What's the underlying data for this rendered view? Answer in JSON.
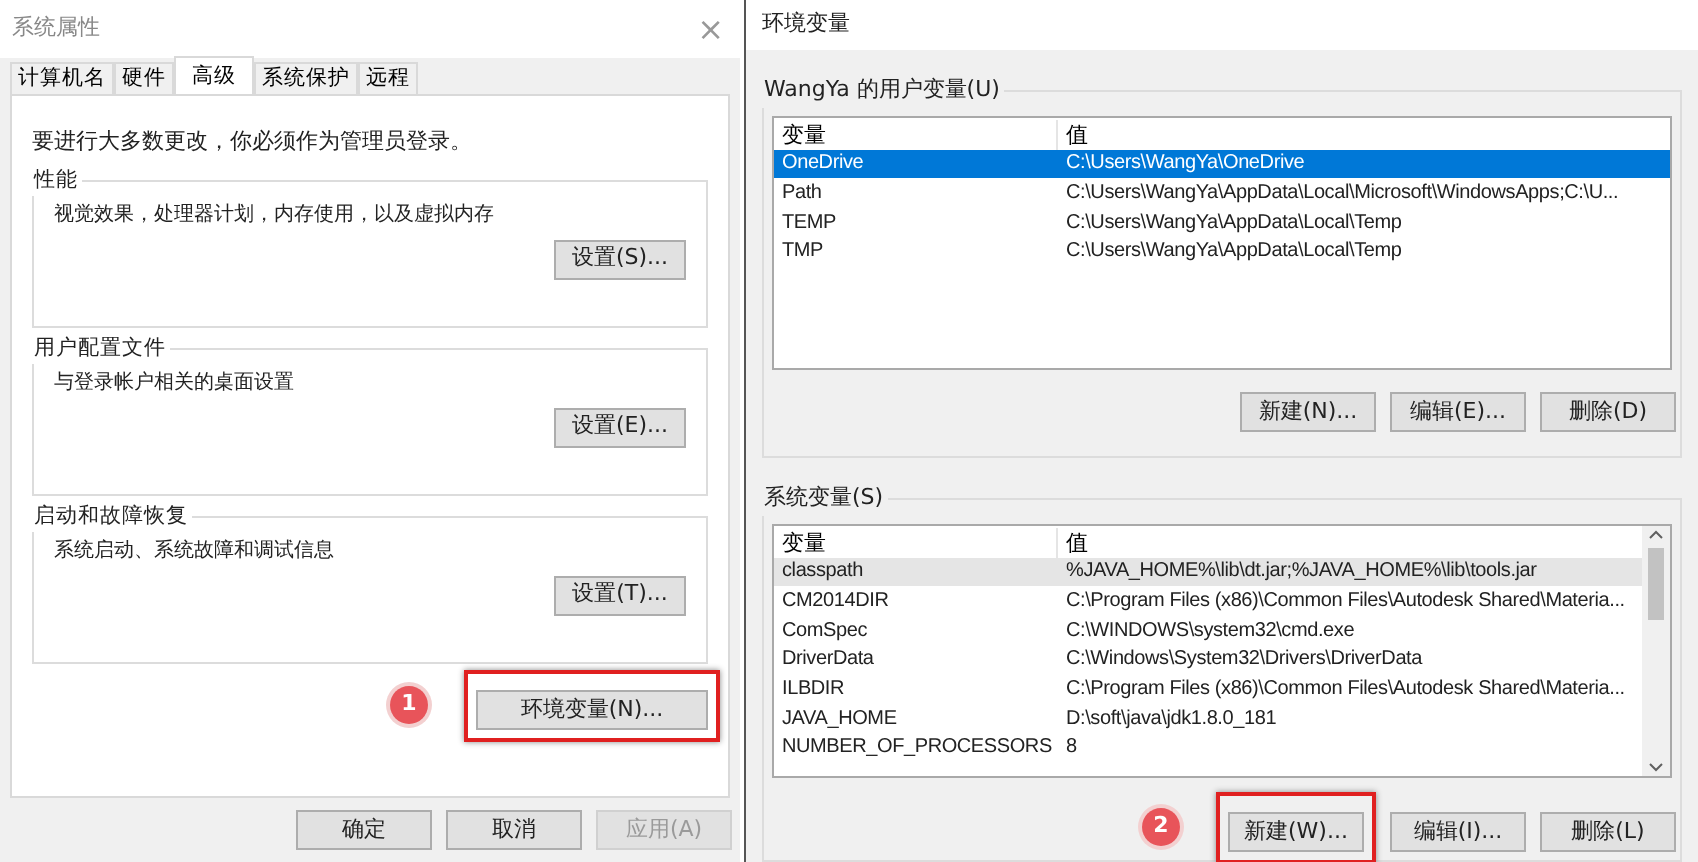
{
  "system_properties": {
    "title": "系统属性",
    "close": "×",
    "tabs": [
      {
        "label": "计算机名",
        "selected": false
      },
      {
        "label": "硬件",
        "selected": false
      },
      {
        "label": "高级",
        "selected": true
      },
      {
        "label": "系统保护",
        "selected": false
      },
      {
        "label": "远程",
        "selected": false
      }
    ],
    "notice": "要进行大多数更改，你必须作为管理员登录。",
    "groups": [
      {
        "title": "性能",
        "description": "视觉效果，处理器计划，内存使用，以及虚拟内存",
        "button": "设置(S)..."
      },
      {
        "title": "用户配置文件",
        "description": "与登录帐户相关的桌面设置",
        "button": "设置(E)..."
      },
      {
        "title": "启动和故障恢复",
        "description": "系统启动、系统故障和调试信息",
        "button": "设置(T)..."
      }
    ],
    "env_button": {
      "label": "环境变量(N)...",
      "highlighted": true,
      "marker": "1"
    },
    "buttons": [
      {
        "label": "确定",
        "disabled": false
      },
      {
        "label": "取消",
        "disabled": false
      },
      {
        "label": "应用(A)",
        "disabled": true
      }
    ]
  },
  "environment_variables": {
    "title": "环境变量",
    "lists": [
      {
        "title": "WangYa 的用户变量(U)",
        "focused": true,
        "scrollbar": false,
        "columns": [
          "变量",
          "值"
        ],
        "rows": [
          {
            "name": "OneDrive",
            "value": "C:\\Users\\WangYa\\OneDrive",
            "selected": true
          },
          {
            "name": "Path",
            "value": "C:\\Users\\WangYa\\AppData\\Local\\Microsoft\\WindowsApps;C:\\U...",
            "selected": false
          },
          {
            "name": "TEMP",
            "value": "C:\\Users\\WangYa\\AppData\\Local\\Temp",
            "selected": false
          },
          {
            "name": "TMP",
            "value": "C:\\Users\\WangYa\\AppData\\Local\\Temp",
            "selected": false
          }
        ],
        "buttons": [
          {
            "label": "新建(N)...",
            "highlighted": false
          },
          {
            "label": "编辑(E)...",
            "highlighted": false
          },
          {
            "label": "删除(D)",
            "highlighted": false
          }
        ]
      },
      {
        "title": "系统变量(S)",
        "focused": false,
        "scrollbar": true,
        "columns": [
          "变量",
          "值"
        ],
        "rows": [
          {
            "name": "classpath",
            "value": "%JAVA_HOME%\\lib\\dt.jar;%JAVA_HOME%\\lib\\tools.jar",
            "selected": true
          },
          {
            "name": "CM2014DIR",
            "value": "C:\\Program Files (x86)\\Common Files\\Autodesk Shared\\Materia...",
            "selected": false
          },
          {
            "name": "ComSpec",
            "value": "C:\\WINDOWS\\system32\\cmd.exe",
            "selected": false
          },
          {
            "name": "DriverData",
            "value": "C:\\Windows\\System32\\Drivers\\DriverData",
            "selected": false
          },
          {
            "name": "ILBDIR",
            "value": "C:\\Program Files (x86)\\Common Files\\Autodesk Shared\\Materia...",
            "selected": false
          },
          {
            "name": "JAVA_HOME",
            "value": "D:\\soft\\java\\jdk1.8.0_181",
            "selected": false
          },
          {
            "name": "NUMBER_OF_PROCESSORS",
            "value": "8",
            "selected": false
          }
        ],
        "buttons": [
          {
            "label": "新建(W)...",
            "highlighted": true,
            "marker": "2"
          },
          {
            "label": "编辑(I)...",
            "highlighted": false
          },
          {
            "label": "删除(L)",
            "highlighted": false
          }
        ]
      }
    ]
  }
}
